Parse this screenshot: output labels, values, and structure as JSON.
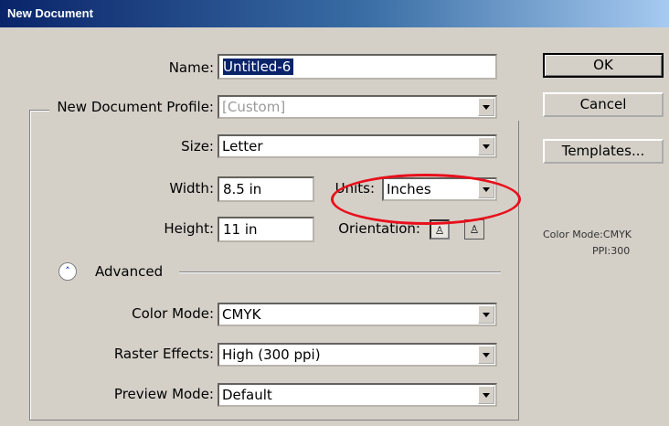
{
  "window": {
    "title": "New Document"
  },
  "fields": {
    "name": {
      "label": "Name:",
      "value": "Untitled-6"
    },
    "profile": {
      "label": "New Document Profile:",
      "value": "[Custom]"
    },
    "size": {
      "label": "Size:",
      "value": "Letter"
    },
    "width": {
      "label": "Width:",
      "value": "8.5 in"
    },
    "units": {
      "label": "Units:",
      "value": "Inches"
    },
    "height": {
      "label": "Height:",
      "value": "11 in"
    },
    "orientation": {
      "label": "Orientation:",
      "options": [
        "portrait",
        "landscape"
      ],
      "selected": "portrait"
    },
    "advanced": {
      "label": "Advanced",
      "icon": "double-chevron-up-icon"
    },
    "color_mode": {
      "label": "Color Mode:",
      "value": "CMYK"
    },
    "raster": {
      "label": "Raster Effects:",
      "value": "High (300 ppi)"
    },
    "preview": {
      "label": "Preview Mode:",
      "value": "Default"
    }
  },
  "buttons": {
    "ok": "OK",
    "cancel": "Cancel",
    "templates": "Templates..."
  },
  "info": {
    "color_mode": "Color Mode:CMYK",
    "ppi": "PPI:300"
  },
  "annotation": {
    "shape": "ellipse",
    "color": "#e8101c",
    "target": "units"
  },
  "colors": {
    "titlebar_start": "#0a246a",
    "titlebar_end": "#a6caf0",
    "dialog_bg": "#d4d0c8"
  }
}
